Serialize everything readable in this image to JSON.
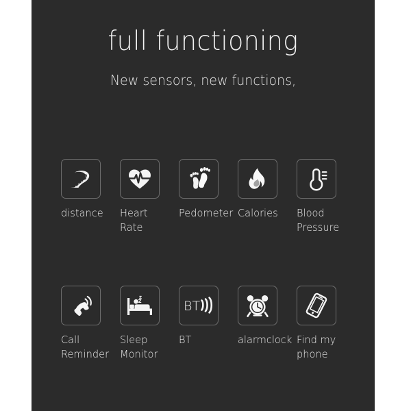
{
  "panel": {
    "background_color": "#2b2b2b",
    "page_background_color": "#ffffff",
    "text_color": "#e8e8e8",
    "tile_border_color": "#6e6e6e"
  },
  "header": {
    "title": "full functioning",
    "subtitle": "New sensors, new functions,"
  },
  "features": {
    "rows": [
      {
        "items": [
          {
            "icon": "winding-road-icon",
            "label": "distance"
          },
          {
            "icon": "heart-rate-icon",
            "label": "Heart\nRate"
          },
          {
            "icon": "footprints-icon",
            "label": "Pedometer"
          },
          {
            "icon": "flame-icon",
            "label": "Calories"
          },
          {
            "icon": "thermometer-icon",
            "label": "Blood\nPressure"
          }
        ]
      },
      {
        "items": [
          {
            "icon": "ringing-phone-icon",
            "label": "Call\nReminder"
          },
          {
            "icon": "bed-sleep-icon",
            "label": "Sleep\nMonitor"
          },
          {
            "icon": "bluetooth-signal-icon",
            "label": "BT"
          },
          {
            "icon": "alarm-clock-icon",
            "label": "alarmclock"
          },
          {
            "icon": "tilted-smartphone-icon",
            "label": "Find my\nphone"
          }
        ]
      }
    ]
  }
}
